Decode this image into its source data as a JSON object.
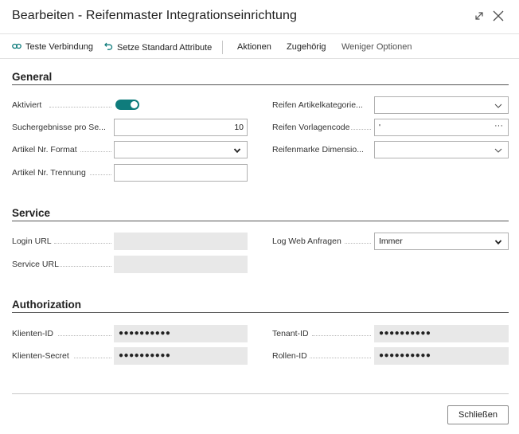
{
  "window": {
    "title": "Bearbeiten - Reifenmaster Integrationseinrichtung"
  },
  "actions": {
    "test_connection": "Teste Verbindung",
    "set_default_attributes": "Setze Standard Attribute",
    "actions": "Aktionen",
    "related": "Zugehörig",
    "fewer_options": "Weniger Optionen"
  },
  "general": {
    "title": "General",
    "activated_label": "Aktiviert",
    "activated_value": true,
    "search_results_label": "Suchergebnisse pro Se...",
    "search_results_value": "10",
    "item_no_format_label": "Artikel Nr. Format",
    "item_no_format_value": "",
    "item_no_separator_label": "Artikel Nr. Trennung",
    "item_no_separator_value": "",
    "tire_item_category_label": "Reifen Artikelkategorie...",
    "tire_item_category_value": "",
    "tire_template_code_label": "Reifen Vorlagencode",
    "tire_template_code_value": "'",
    "tire_brand_dimension_label": "Reifenmarke Dimensio...",
    "tire_brand_dimension_value": ""
  },
  "service": {
    "title": "Service",
    "login_url_label": "Login URL",
    "login_url_value": "",
    "service_url_label": "Service URL",
    "service_url_value": "",
    "log_web_requests_label": "Log Web Anfragen",
    "log_web_requests_value": "Immer"
  },
  "authorization": {
    "title": "Authorization",
    "client_id_label": "Klienten-ID",
    "client_id_value": "●●●●●●●●●●",
    "client_secret_label": "Klienten-Secret",
    "client_secret_value": "●●●●●●●●●●",
    "tenant_id_label": "Tenant-ID",
    "tenant_id_value": "●●●●●●●●●●",
    "role_id_label": "Rollen-ID",
    "role_id_value": "●●●●●●●●●●"
  },
  "footer": {
    "close_label": "Schließen"
  },
  "colors": {
    "accent": "#0f7c7c",
    "readonly_bg": "#e8e8e8"
  }
}
